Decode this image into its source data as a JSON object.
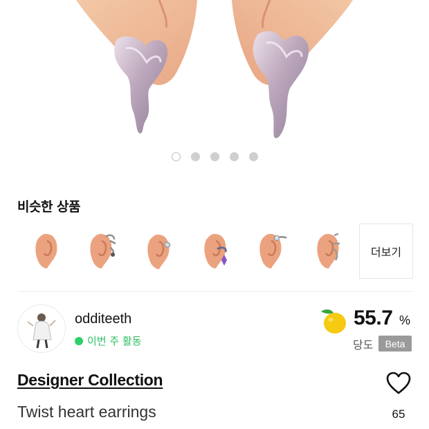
{
  "hero": {
    "image": "twist-heart-earrings-product-photo",
    "carousel_total": 5,
    "carousel_active": 1
  },
  "similar": {
    "title": "비슷한 상품",
    "items": [
      {
        "image": "ear-earring-thumbnail-1"
      },
      {
        "image": "ear-earring-thumbnail-2"
      },
      {
        "image": "ear-earring-thumbnail-3"
      },
      {
        "image": "ear-earring-thumbnail-4"
      },
      {
        "image": "ear-earring-thumbnail-5"
      },
      {
        "image": "ear-earring-thumbnail-6"
      }
    ],
    "more_label": "더보기"
  },
  "seller": {
    "name": "odditeeth",
    "activity": "이번 주 활동",
    "avatar": "seller-avatar-photo"
  },
  "sweetness": {
    "icon": "yellow-apple-icon",
    "value": "55.7",
    "unit": "%",
    "label": "당도",
    "badge": "Beta"
  },
  "product": {
    "brand": "Designer Collection",
    "name": "Twist heart earrings",
    "likes": "65"
  },
  "colors": {
    "accent_green": "#2fcf6a",
    "badge_gray": "#9a9a9a"
  }
}
